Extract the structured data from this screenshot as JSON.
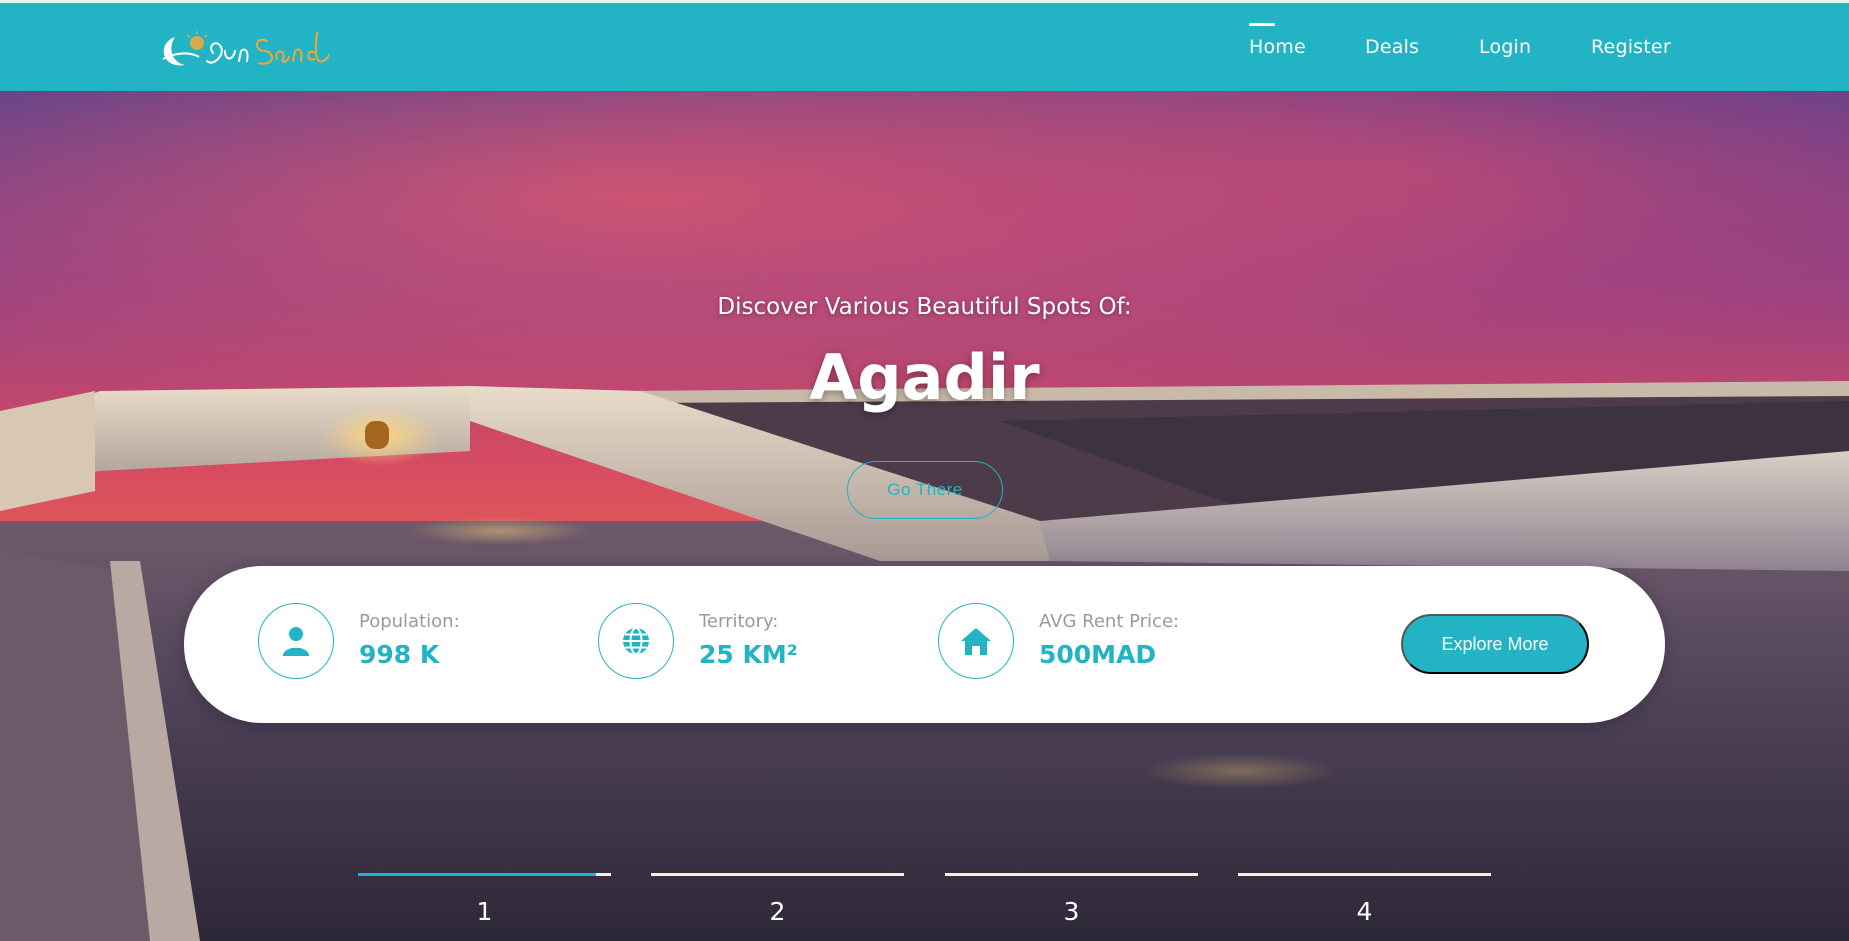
{
  "brand": {
    "logo_alt": "Sun Sand"
  },
  "nav": {
    "items": [
      {
        "label": "Home",
        "active": true
      },
      {
        "label": "Deals",
        "active": false
      },
      {
        "label": "Login",
        "active": false
      },
      {
        "label": "Register",
        "active": false
      }
    ]
  },
  "hero": {
    "subtitle": "Discover Various Beautiful Spots Of:",
    "title": "Agadir",
    "cta_label": "Go There"
  },
  "info": {
    "stats": [
      {
        "icon": "user-icon",
        "label": "Population:",
        "value": "998 K"
      },
      {
        "icon": "globe-icon",
        "label": "Territory:",
        "value": "25 KM²"
      },
      {
        "icon": "home-icon",
        "label": "AVG Rent Price:",
        "value": "500MAD"
      }
    ],
    "explore_label": "Explore More"
  },
  "slider": {
    "pages": [
      "1",
      "2",
      "3",
      "4"
    ],
    "active_index": 0,
    "active_progress": 0.94
  },
  "colors": {
    "accent": "#22b3c4",
    "white": "#ffffff",
    "muted_text": "#9a9a9a",
    "pager_bar": "#f2efe3"
  }
}
